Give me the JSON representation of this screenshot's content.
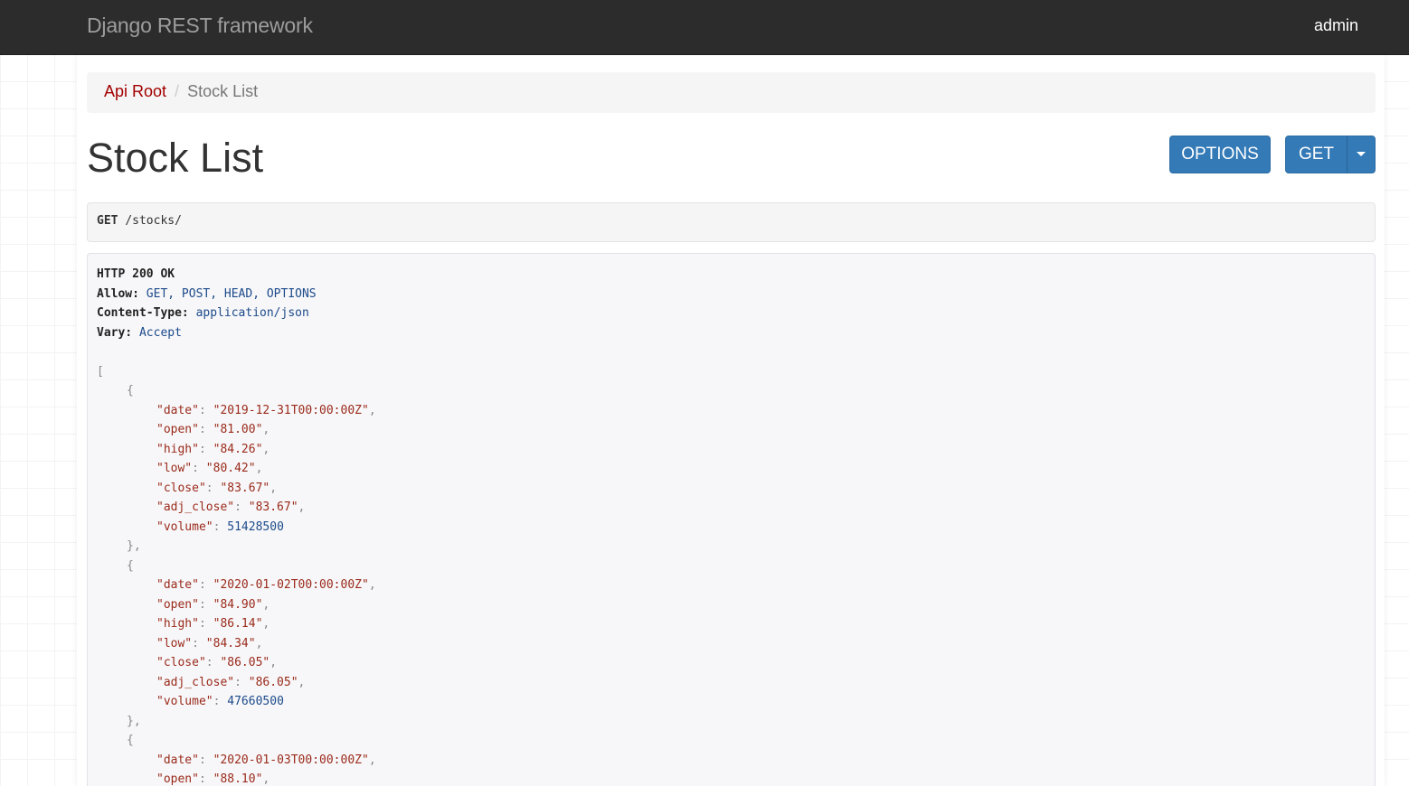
{
  "navbar": {
    "brand": "Django REST framework",
    "user": "admin"
  },
  "breadcrumb": {
    "root": "Api Root",
    "separator": "/",
    "current": "Stock List"
  },
  "page": {
    "title": "Stock List"
  },
  "buttons": {
    "options": "OPTIONS",
    "get": "GET"
  },
  "request": {
    "method": "GET",
    "path": "/stocks/"
  },
  "response": {
    "status": "HTTP 200 OK",
    "headers": [
      {
        "name": "Allow:",
        "value": "GET, POST, HEAD, OPTIONS"
      },
      {
        "name": "Content-Type:",
        "value": "application/json"
      },
      {
        "name": "Vary:",
        "value": "Accept"
      }
    ],
    "open_bracket": "[",
    "items": [
      {
        "date": "\"2019-12-31T00:00:00Z\"",
        "open": "\"81.00\"",
        "high": "\"84.26\"",
        "low": "\"80.42\"",
        "close": "\"83.67\"",
        "adj_close": "\"83.67\"",
        "volume": "51428500"
      },
      {
        "date": "\"2020-01-02T00:00:00Z\"",
        "open": "\"84.90\"",
        "high": "\"86.14\"",
        "low": "\"84.34\"",
        "close": "\"86.05\"",
        "adj_close": "\"86.05\"",
        "volume": "47660500"
      },
      {
        "date": "\"2020-01-03T00:00:00Z\"",
        "open": "\"88.10\""
      }
    ],
    "keys": {
      "date": "\"date\"",
      "open": "\"open\"",
      "high": "\"high\"",
      "low": "\"low\"",
      "close": "\"close\"",
      "adj_close": "\"adj_close\"",
      "volume": "\"volume\""
    }
  },
  "colors": {
    "navbar_bg": "#2c2c2c",
    "primary_button": "#337ab7",
    "breadcrumb_link": "#a30000",
    "json_string": "#9a2a1a",
    "json_number": "#1c4a8a"
  },
  "icons": {
    "dropdown": "caret-down-icon"
  }
}
